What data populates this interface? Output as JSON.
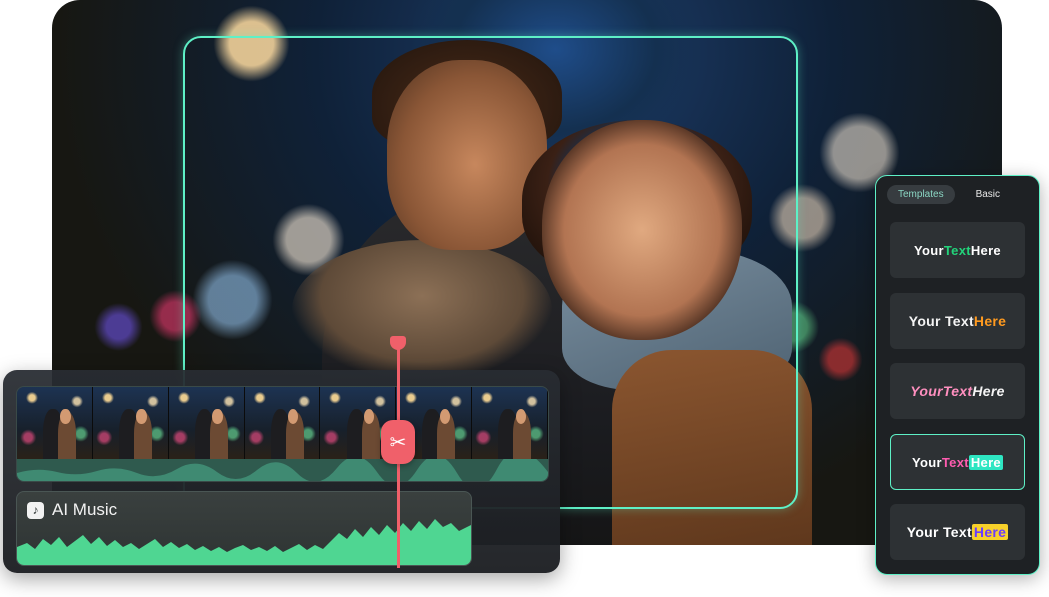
{
  "audio_track": {
    "label": "AI Music"
  },
  "text_panel": {
    "tabs": [
      "Templates",
      "Basic"
    ],
    "active_tab": "Templates",
    "templates": [
      {
        "parts": [
          "Your ",
          "Text",
          " Here"
        ],
        "highlight_color": "#22d37a",
        "selected": false
      },
      {
        "parts": [
          "Your Text ",
          "Here"
        ],
        "highlight_color": "#ff9a1f",
        "selected": false
      },
      {
        "parts": [
          "Your ",
          "Text",
          " Here"
        ],
        "highlight_color": "#ff8fbf",
        "selected": false
      },
      {
        "parts": [
          "Your ",
          "Text",
          "Here"
        ],
        "highlight_color": "#2ee6c2",
        "selected": true
      },
      {
        "parts": [
          "Your Text ",
          "Here"
        ],
        "highlight_color": "#f7d12a",
        "selected": false
      }
    ]
  },
  "colors": {
    "accent": "#5ef0c6",
    "playhead": "#f0606a",
    "audio_wave": "#4fd692"
  },
  "icons": {
    "cut": "scissors-icon",
    "music": "music-note-icon",
    "cursor": "pointer-cursor-icon"
  }
}
